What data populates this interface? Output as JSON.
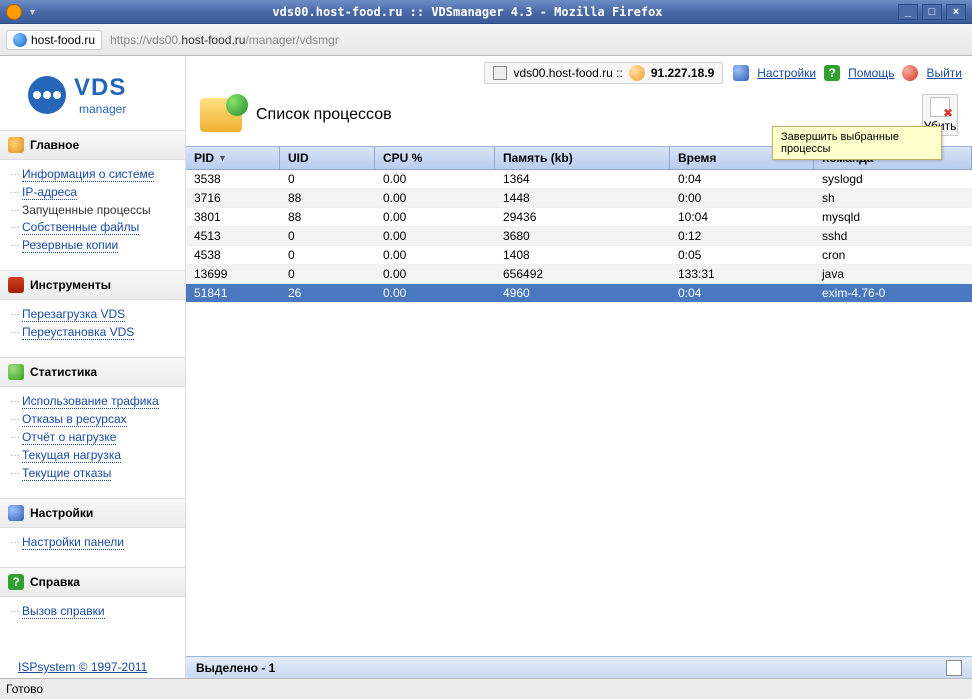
{
  "window": {
    "title": "vds00.host-food.ru :: VDSmanager 4.3 - Mozilla Firefox"
  },
  "urlbar": {
    "host": "host-food.ru",
    "url_grey1": "https://vds00.",
    "url_dark": "host-food.ru",
    "url_grey2": "/manager/vdsmgr"
  },
  "logo": {
    "line1": "VDS",
    "line2": "manager"
  },
  "sidebar": [
    {
      "title": "Главное",
      "icon": "disk",
      "links": [
        {
          "label": "Информация о системе"
        },
        {
          "label": "IP-адреса"
        },
        {
          "label": "Запущенные процессы",
          "active": true
        },
        {
          "label": "Собственные файлы"
        },
        {
          "label": "Резервные копии"
        }
      ]
    },
    {
      "title": "Инструменты",
      "icon": "tools",
      "links": [
        {
          "label": "Перезагрузка VDS"
        },
        {
          "label": "Переустановка VDS"
        }
      ]
    },
    {
      "title": "Статистика",
      "icon": "stats",
      "links": [
        {
          "label": "Использование трафика"
        },
        {
          "label": "Отказы в ресурсах"
        },
        {
          "label": "Отчёт о нагрузке"
        },
        {
          "label": "Текущая нагрузка"
        },
        {
          "label": "Текущие отказы"
        }
      ]
    },
    {
      "title": "Настройки",
      "icon": "gear",
      "links": [
        {
          "label": "Настройки панели"
        }
      ]
    },
    {
      "title": "Справка",
      "icon": "help",
      "links": [
        {
          "label": "Вызов справки"
        }
      ]
    }
  ],
  "sidebar_footer": "ISPsystem © 1997-2011",
  "topbar": {
    "server": "vds00.host-food.ru ::",
    "ip": "91.227.18.9",
    "settings": "Настройки",
    "help": "Помощь",
    "exit": "Выйти"
  },
  "page_title": "Список процессов",
  "action_delete": "Убить",
  "tooltip": "Завершить выбранные процессы",
  "columns": {
    "pid": "PID",
    "uid": "UID",
    "cpu": "CPU %",
    "mem": "Память (kb)",
    "time": "Время",
    "cmd": "Команда"
  },
  "rows": [
    {
      "pid": "3538",
      "uid": "0",
      "cpu": "0.00",
      "mem": "1364",
      "time": "0:04",
      "cmd": "syslogd"
    },
    {
      "pid": "3716",
      "uid": "88",
      "cpu": "0.00",
      "mem": "1448",
      "time": "0:00",
      "cmd": "sh"
    },
    {
      "pid": "3801",
      "uid": "88",
      "cpu": "0.00",
      "mem": "29436",
      "time": "10:04",
      "cmd": "mysqld"
    },
    {
      "pid": "4513",
      "uid": "0",
      "cpu": "0.00",
      "mem": "3680",
      "time": "0:12",
      "cmd": "sshd"
    },
    {
      "pid": "4538",
      "uid": "0",
      "cpu": "0.00",
      "mem": "1408",
      "time": "0:05",
      "cmd": "cron"
    },
    {
      "pid": "13699",
      "uid": "0",
      "cpu": "0.00",
      "mem": "656492",
      "time": "133:31",
      "cmd": "java"
    },
    {
      "pid": "51841",
      "uid": "26",
      "cpu": "0.00",
      "mem": "4960",
      "time": "0:04",
      "cmd": "exim-4.76-0",
      "selected": true
    }
  ],
  "bottombar": "Выделено - 1",
  "statusbar": "Готово"
}
